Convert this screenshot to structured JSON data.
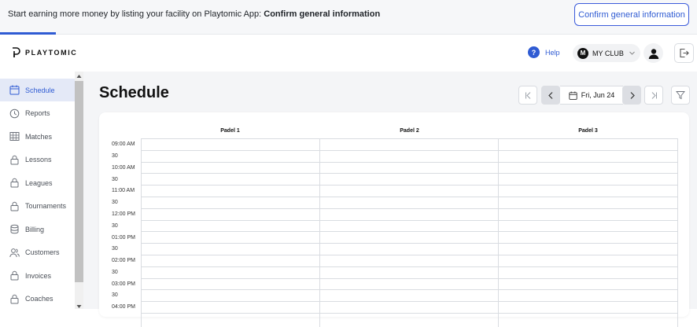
{
  "banner": {
    "text": "Start earning more money by listing your facility on Playtomic App: ",
    "text_bold": "Confirm general information",
    "button_label": "Confirm general information"
  },
  "header": {
    "logo_text": "PLAYTOMIC",
    "help_label": "Help",
    "club_initial": "M",
    "club_name": "MY CLUB"
  },
  "sidebar": {
    "items": [
      {
        "label": "Schedule",
        "icon": "calendar-icon",
        "active": true
      },
      {
        "label": "Reports",
        "icon": "clock-icon",
        "active": false
      },
      {
        "label": "Matches",
        "icon": "grid-icon",
        "active": false
      },
      {
        "label": "Lessons",
        "icon": "lock-icon",
        "active": false
      },
      {
        "label": "Leagues",
        "icon": "lock-icon",
        "active": false
      },
      {
        "label": "Tournaments",
        "icon": "lock-icon",
        "active": false
      },
      {
        "label": "Billing",
        "icon": "coins-icon",
        "active": false
      },
      {
        "label": "Customers",
        "icon": "users-icon",
        "active": false
      },
      {
        "label": "Invoices",
        "icon": "lock-icon",
        "active": false
      },
      {
        "label": "Coaches",
        "icon": "lock-icon",
        "active": false
      }
    ]
  },
  "main": {
    "title": "Schedule",
    "date_label": "Fri, Jun 24",
    "courts": [
      "Padel 1",
      "Padel 2",
      "Padel 3"
    ],
    "time_slots": [
      "09:00 AM",
      "30",
      "10:00 AM",
      "30",
      "11:00 AM",
      "30",
      "12:00 PM",
      "30",
      "01:00 PM",
      "30",
      "02:00 PM",
      "30",
      "03:00 PM",
      "30",
      "04:00 PM"
    ]
  },
  "colors": {
    "accent": "#2f5bd3",
    "active_bg": "#e4e9f7",
    "page_bg": "#f4f5f7"
  }
}
